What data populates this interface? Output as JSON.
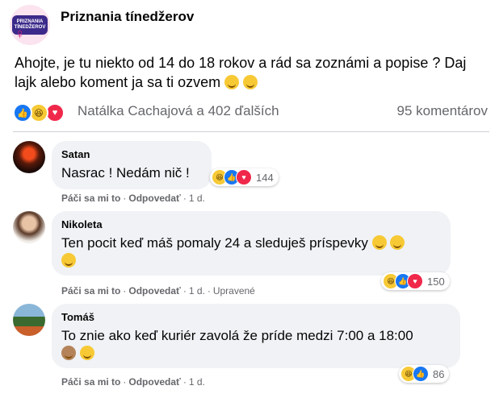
{
  "post": {
    "group_name": "Priznania tínedžerov",
    "logo_text": "PRIZNANIA TÍNEDŽEROV",
    "text": "Ahojte, je tu niekto od 14 do 18 rokov a rád sa zoznámi a popise ? Daj lajk alebo koment ja sa ti ozvem",
    "reactions_names": "Natálka Cachajová a 402 ďalších",
    "comment_count": "95 komentárov",
    "reaction_icons": [
      "like-icon",
      "haha-icon",
      "love-icon"
    ]
  },
  "comments": [
    {
      "author": "Satan",
      "text": "Nasrac ! Nedám nič !",
      "reaction_count": "144",
      "like_label": "Páči sa mi to",
      "reply_label": "Odpovedať",
      "time": "1 d.",
      "edited": ""
    },
    {
      "author": "Nikoleta",
      "text": "Ten pocit keď máš pomaly 24 a sleduješ príspevky",
      "reaction_count": "150",
      "like_label": "Páči sa mi to",
      "reply_label": "Odpovedať",
      "time": "1 d.",
      "edited": "Upravené"
    },
    {
      "author": "Tomáš",
      "text": "To znie ako keď kuriér zavolá že príde medzi 7:00 a 18:00",
      "reaction_count": "86",
      "like_label": "Páči sa mi to",
      "reply_label": "Odpovedať",
      "time": "1 d.",
      "edited": ""
    }
  ],
  "colors": {
    "like": "#1877f2",
    "love": "#f0284a",
    "haha": "#f7c935",
    "bubble": "#f0f2f5",
    "secondary_text": "#65676b"
  }
}
